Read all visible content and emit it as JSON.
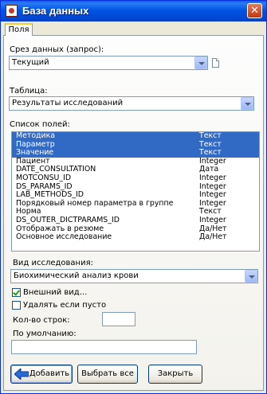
{
  "window": {
    "title": "База данных",
    "close_glyph": "✕"
  },
  "tabs": [
    {
      "label": "Поля"
    }
  ],
  "slice": {
    "label": "Срез данных (запрос):",
    "value": "Текущий",
    "side_icon": "document-icon"
  },
  "table": {
    "label": "Таблица:",
    "value": "Результаты исследований"
  },
  "fields": {
    "label": "Список полей:",
    "rows": [
      {
        "name": "Методика",
        "type": "Текст",
        "selected": true
      },
      {
        "name": "Параметр",
        "type": "Текст",
        "selected": true
      },
      {
        "name": "Значение",
        "type": "Текст",
        "selected": true
      },
      {
        "name": "Пациент",
        "type": "Integer",
        "selected": false
      },
      {
        "name": "DATE_CONSULTATION",
        "type": "Дата",
        "selected": false
      },
      {
        "name": "MOTCONSU_ID",
        "type": "Integer",
        "selected": false
      },
      {
        "name": "DS_PARAMS_ID",
        "type": "Integer",
        "selected": false
      },
      {
        "name": "LAB_METHODS_ID",
        "type": "Integer",
        "selected": false
      },
      {
        "name": "Порядковый номер параметра в группе",
        "type": "Integer",
        "selected": false
      },
      {
        "name": "Норма",
        "type": "Текст",
        "selected": false
      },
      {
        "name": "DS_OUTER_DICTPARAMS_ID",
        "type": "Integer",
        "selected": false
      },
      {
        "name": "Отображать в резюме",
        "type": "Да/Нет",
        "selected": false
      },
      {
        "name": "Основное исследование",
        "type": "Да/Нет",
        "selected": false
      }
    ]
  },
  "study_type": {
    "label": "Вид исследования:",
    "value": "Биохимический анализ крови"
  },
  "external_view": {
    "label": "Внешний вид...",
    "checked": true
  },
  "delete_if_empty": {
    "label": "Удалять если пусто",
    "checked": false
  },
  "row_count": {
    "label": "Кол-во строк:",
    "value": ""
  },
  "default_value": {
    "label": "По умолчанию:",
    "value": ""
  },
  "buttons": {
    "add": "Добавить",
    "select_all": "Выбрать все",
    "close": "Закрыть"
  },
  "colors": {
    "selection": "#316ac5",
    "titlebar": "#0055e5",
    "dialog_bg": "#ece9d8"
  }
}
